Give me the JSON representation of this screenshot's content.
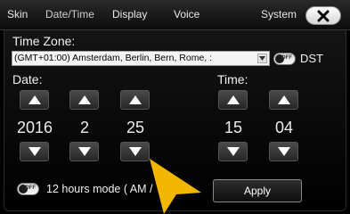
{
  "tabs": [
    {
      "label": "Skin"
    },
    {
      "label": "Date/Time"
    },
    {
      "label": "Display"
    },
    {
      "label": "Voice"
    },
    {
      "label": "System"
    }
  ],
  "time_zone": {
    "label": "Time Zone:",
    "selected": "(GMT+01:00) Amsterdam, Berlin, Bern, Rome, :"
  },
  "dst": {
    "label": "DST",
    "state": "OFF"
  },
  "date": {
    "label": "Date:",
    "year": "2016",
    "month": "2",
    "day": "25"
  },
  "time": {
    "label": "Time:",
    "hour": "15",
    "minute": "04"
  },
  "hours_mode": {
    "label": "12 hours mode ( AM / ",
    "state": "OFF"
  },
  "apply_label": "Apply",
  "colors": {
    "pointer": "#f3b600",
    "background": "#000000",
    "accent_text": "#ffffff"
  },
  "icons": [
    "close-icon",
    "chevron-down-icon",
    "up-arrow-icon",
    "down-arrow-icon",
    "pointer-arrow-icon"
  ]
}
